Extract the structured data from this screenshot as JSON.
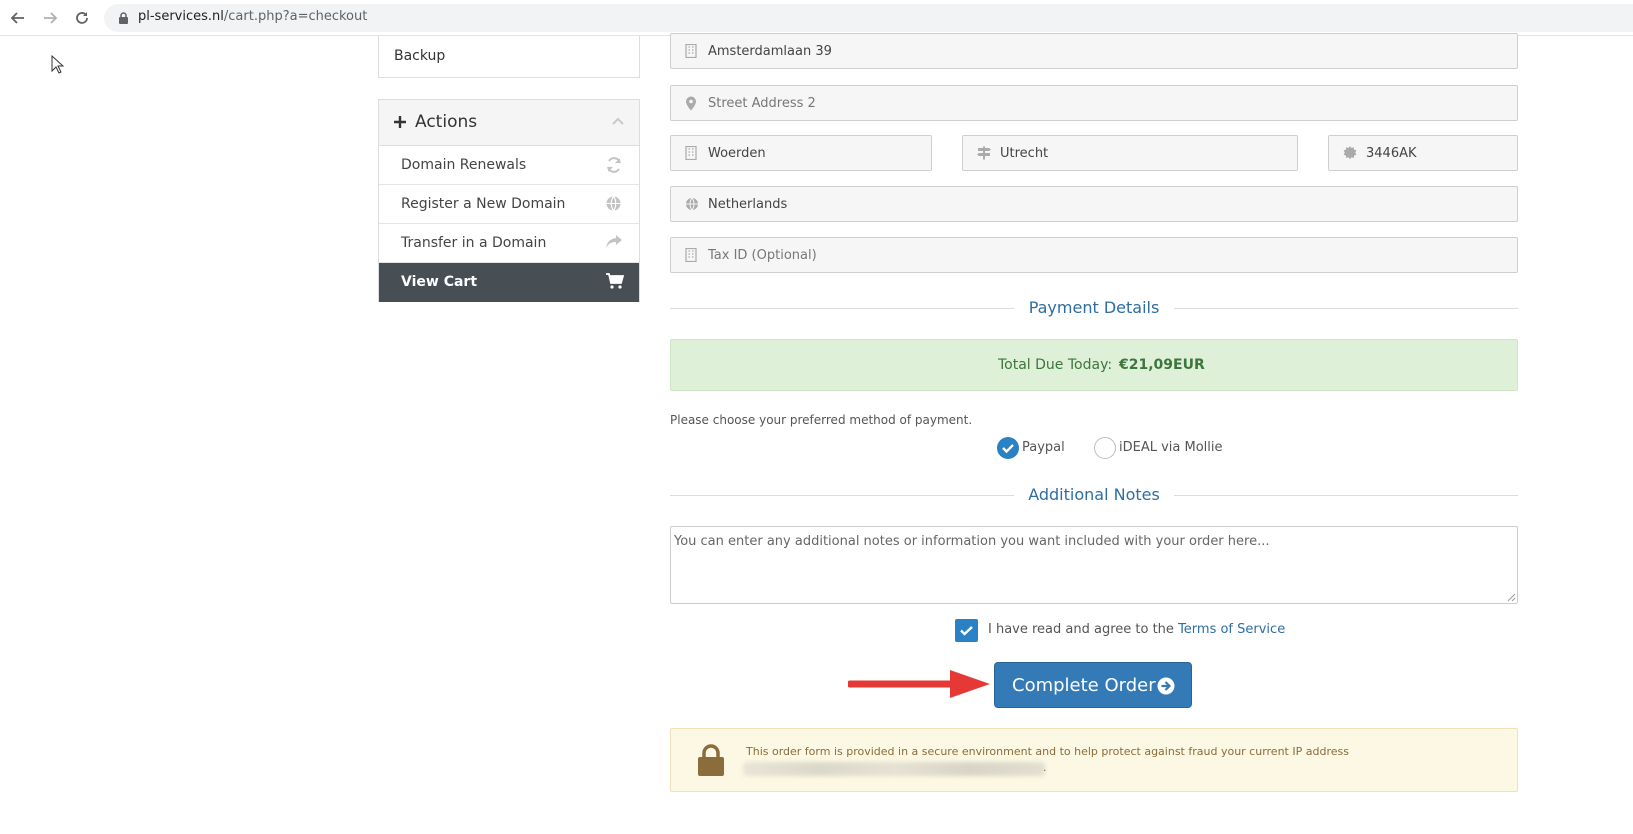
{
  "browser": {
    "url_domain": "pl-services.nl",
    "url_path": "/cart.php?a=checkout"
  },
  "sidebar": {
    "backup_label": "Backup",
    "actions_title": "Actions",
    "items": [
      {
        "label": "Domain Renewals",
        "icon": "refresh-icon"
      },
      {
        "label": "Register a New Domain",
        "icon": "globe-icon"
      },
      {
        "label": "Transfer in a Domain",
        "icon": "share-arrow-icon"
      },
      {
        "label": "View Cart",
        "icon": "cart-icon",
        "active": true
      }
    ]
  },
  "form": {
    "address1": "Amsterdamlaan 39",
    "address2_placeholder": "Street Address 2",
    "city": "Woerden",
    "state": "Utrecht",
    "postcode": "3446AK",
    "country": "Netherlands",
    "tax_placeholder": "Tax ID (Optional)"
  },
  "payment": {
    "section_title": "Payment Details",
    "total_label": "Total Due Today:",
    "total_value": "€21,09EUR",
    "prompt": "Please choose your preferred method of payment.",
    "methods": [
      {
        "label": "Paypal",
        "selected": true
      },
      {
        "label": "iDEAL via Mollie",
        "selected": false
      }
    ]
  },
  "notes": {
    "section_title": "Additional Notes",
    "placeholder": "You can enter any additional notes or information you want included with your order here..."
  },
  "tos": {
    "text": "I have read and agree to the",
    "link": "Terms of Service",
    "checked": true
  },
  "order": {
    "button_label": "Complete Order"
  },
  "secure": {
    "text": "This order form is provided in a secure environment and to help protect against fraud your current IP address",
    "suffix": "."
  },
  "colors": {
    "primary": "#337ab7",
    "active_sidebar": "#474f55",
    "success_bg": "#dff0d8",
    "warning_bg": "#fcf8e3",
    "annotation_arrow": "#e53935"
  }
}
